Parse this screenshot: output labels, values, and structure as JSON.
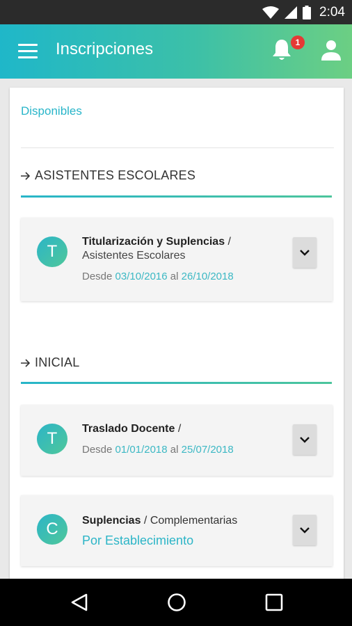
{
  "status_bar": {
    "time": "2:04"
  },
  "app_bar": {
    "title": "Inscripciones",
    "notification_count": "1",
    "icons": [
      "menu-icon",
      "bell-icon",
      "person-icon"
    ]
  },
  "tab": {
    "label": "Disponibles"
  },
  "sections": [
    {
      "title": "ASISTENTES ESCOLARES",
      "items": [
        {
          "avatar": "T",
          "title_bold": "Titularización y Suplencias",
          "title_rest": " /",
          "subtitle": "Asistentes Escolares",
          "dates_prefix": "Desde",
          "date_from": "03/10/2016",
          "dates_mid": "al",
          "date_to": "26/10/2018"
        }
      ]
    },
    {
      "title": "INICIAL",
      "items": [
        {
          "avatar": "T",
          "title_bold": "Traslado Docente",
          "title_rest": " /",
          "dates_prefix": "Desde",
          "date_from": "01/01/2018",
          "dates_mid": "al",
          "date_to": "25/07/2018"
        },
        {
          "avatar": "C",
          "title_bold": "Suplencias",
          "title_rest": " / Complementarias",
          "link": "Por Establecimiento"
        }
      ]
    }
  ],
  "colors": {
    "accent": "#28b5c9",
    "accent_green": "#4cc59c",
    "badge": "#e53935",
    "status_bar": "#2b2b2b"
  }
}
